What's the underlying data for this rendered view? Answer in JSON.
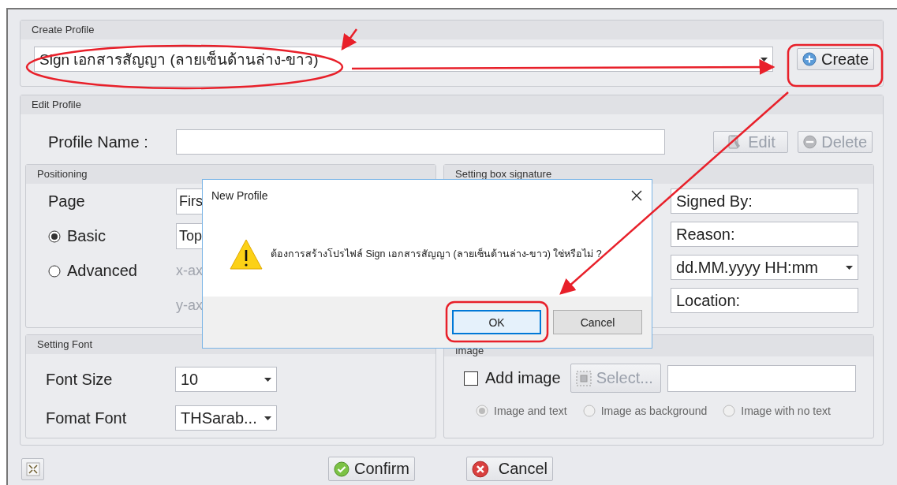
{
  "create_profile": {
    "title": "Create Profile",
    "profile_select": {
      "value": "Sign เอกสารสัญญา (ลายเซ็นด้านล่าง-ขาว)"
    },
    "create_button": {
      "label": "Create"
    }
  },
  "edit_profile": {
    "title": "Edit Profile",
    "profile_name_label": "Profile Name :",
    "edit_button": {
      "label": "Edit",
      "disabled": true
    },
    "delete_button": {
      "label": "Delete",
      "disabled": true
    }
  },
  "positioning": {
    "title": "Positioning",
    "page_label": "Page",
    "page_value": "Firs",
    "modes": [
      {
        "label": "Basic",
        "selected": true,
        "value": "Top"
      },
      {
        "label": "Advanced",
        "selected": false
      }
    ],
    "x_axis_label": "x-ax",
    "y_axis_label": "y-ax"
  },
  "signature_box": {
    "title": "Setting box signature",
    "fields": [
      {
        "kind": "text",
        "value": "Signed By:"
      },
      {
        "kind": "text",
        "value": "Reason:"
      },
      {
        "kind": "dropdown",
        "value": "dd.MM.yyyy HH:mm"
      },
      {
        "kind": "text",
        "value": "Location:"
      }
    ]
  },
  "font": {
    "title": "Setting Font",
    "rows": [
      {
        "label": "Font Size",
        "value": "10"
      },
      {
        "label": "Fomat Font",
        "value": "THSarab..."
      }
    ]
  },
  "image": {
    "title": "Image",
    "add_image": {
      "label": "Add image",
      "checked": false
    },
    "select_button": {
      "label": "Select...",
      "disabled": true
    },
    "layouts": [
      {
        "label": "Image and text",
        "selected": true,
        "disabled": true
      },
      {
        "label": "Image as background",
        "selected": false,
        "disabled": true
      },
      {
        "label": "Image with no text",
        "selected": false,
        "disabled": true
      }
    ]
  },
  "footer": {
    "confirm": "Confirm",
    "cancel": "Cancel"
  },
  "dialog": {
    "title": "New Profile",
    "message": "ต้องการสร้างโปรไฟล์ Sign เอกสารสัญญา (ลายเซ็นด้านล่าง-ขาว) ใช่หรือไม่ ?",
    "buttons": [
      {
        "label": "OK",
        "selected": true
      },
      {
        "label": "Cancel",
        "selected": false
      }
    ]
  }
}
